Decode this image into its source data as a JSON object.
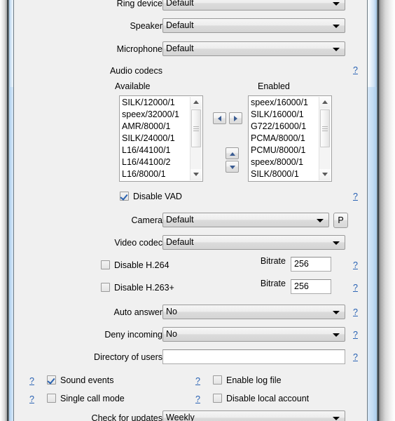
{
  "window": {
    "accent_frame_color": "#a8cbea",
    "client_background": "#f0f0f0",
    "link_color": "#2a63b4"
  },
  "rows": {
    "ring_device": {
      "label": "Ring device",
      "value": "Default"
    },
    "speaker": {
      "label": "Speaker",
      "value": "Default"
    },
    "microphone": {
      "label": "Microphone",
      "value": "Default"
    },
    "camera": {
      "label": "Camera",
      "value": "Default",
      "button_label": "P"
    },
    "video_codec": {
      "label": "Video codec",
      "value": "Default"
    },
    "auto_answer": {
      "label": "Auto answer",
      "value": "No"
    },
    "deny_incoming": {
      "label": "Deny incoming",
      "value": "No"
    },
    "directory_of_users": {
      "label": "Directory of users",
      "value": ""
    },
    "check_for_updates": {
      "label": "Check for updates",
      "value": "Weekly"
    }
  },
  "audio_codecs": {
    "section_label": "Audio codecs",
    "available_caption": "Available",
    "enabled_caption": "Enabled",
    "available": [
      "SILK/12000/1",
      "speex/32000/1",
      "AMR/8000/1",
      "SILK/24000/1",
      "L16/44100/1",
      "L16/44100/2",
      "L16/8000/1"
    ],
    "enabled": [
      "speex/16000/1",
      "SILK/16000/1",
      "G722/16000/1",
      "PCMA/8000/1",
      "PCMU/8000/1",
      "speex/8000/1",
      "SILK/8000/1"
    ],
    "move_left_icon": "arrow-left-icon",
    "move_right_icon": "arrow-right-icon",
    "move_up_icon": "arrow-up-icon",
    "move_down_icon": "arrow-down-icon"
  },
  "checkboxes": {
    "disable_vad": {
      "label": "Disable VAD",
      "checked": true
    },
    "disable_h264": {
      "label": "Disable H.264",
      "checked": false
    },
    "disable_h263p": {
      "label": "Disable H.263+",
      "checked": false
    },
    "sound_events": {
      "label": "Sound events",
      "checked": true
    },
    "single_call_mode": {
      "label": "Single call mode",
      "checked": false
    },
    "enable_log_file": {
      "label": "Enable log file",
      "checked": false
    },
    "disable_local_account": {
      "label": "Disable local account",
      "checked": false
    }
  },
  "bitrate": {
    "h264": {
      "label": "Bitrate",
      "value": "256"
    },
    "h263p": {
      "label": "Bitrate",
      "value": "256"
    }
  },
  "help": {
    "glyph": "?"
  }
}
